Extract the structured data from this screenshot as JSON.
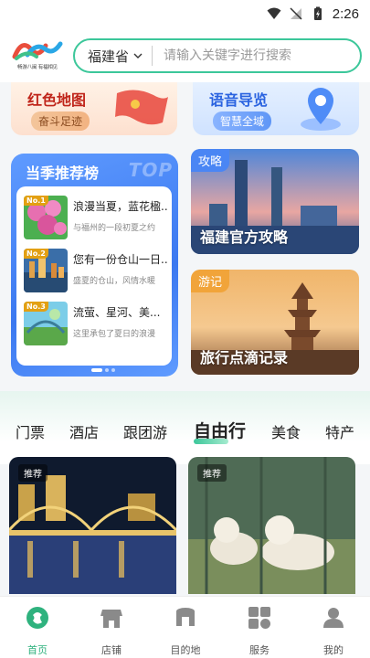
{
  "status_bar": {
    "time": "2:26"
  },
  "header": {
    "logo_subtitle": "畅游八闽 有福相见",
    "region": "福建省",
    "search_placeholder": "请输入关键字进行搜索"
  },
  "top_cards": {
    "red_map": {
      "title": "红色地图",
      "subtitle": "奋斗足迹"
    },
    "audio_guide": {
      "title": "语音导览",
      "subtitle": "智慧全域"
    }
  },
  "seasonal_ranking": {
    "title": "当季推荐榜",
    "watermark": "TOP",
    "items": [
      {
        "rank": "No.1",
        "title": "浪漫当夏，蓝花楹...",
        "subtitle": "与福州的一段初夏之约"
      },
      {
        "rank": "No.2",
        "title": "您有一份仓山一日...",
        "subtitle": "盛夏的仓山，风情水暖"
      },
      {
        "rank": "No.3",
        "title": "流萤、星河、美...",
        "subtitle": "这里承包了夏日的浪漫"
      }
    ]
  },
  "guide_card": {
    "tag": "攻略",
    "caption": "福建官方攻略"
  },
  "notes_card": {
    "tag": "游记",
    "caption": "旅行点滴记录"
  },
  "tabs": [
    "门票",
    "酒店",
    "跟团游",
    "自由行",
    "美食",
    "特产"
  ],
  "active_tab": "自由行",
  "products": [
    {
      "tag": "推荐"
    },
    {
      "tag": "推荐"
    }
  ],
  "bottom_nav": [
    {
      "label": "首页",
      "icon": "home-icon",
      "active": true
    },
    {
      "label": "店铺",
      "icon": "shop-icon",
      "active": false
    },
    {
      "label": "目的地",
      "icon": "destination-icon",
      "active": false
    },
    {
      "label": "服务",
      "icon": "service-icon",
      "active": false
    },
    {
      "label": "我的",
      "icon": "profile-icon",
      "active": false
    }
  ],
  "colors": {
    "accent": "#3cc79a",
    "nav_active": "#2fb27e",
    "ranking_blue": "#4a86f4"
  }
}
